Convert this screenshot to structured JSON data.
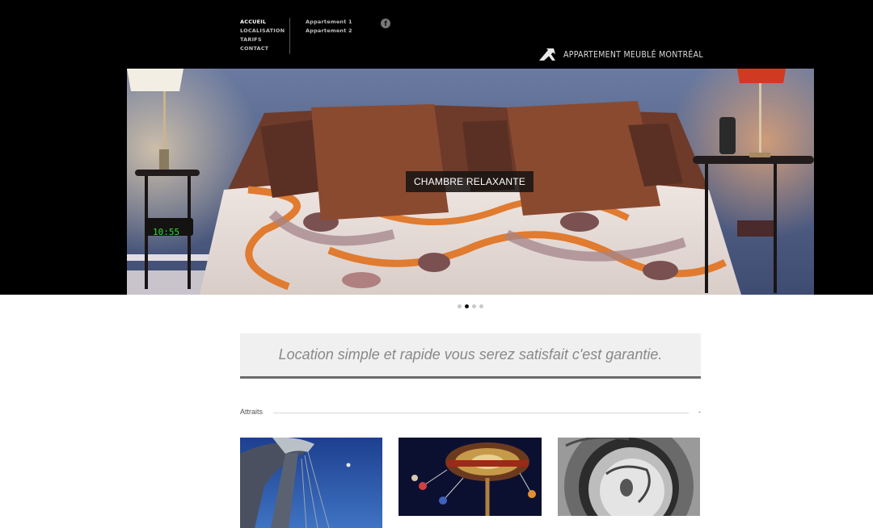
{
  "nav": {
    "primary": [
      {
        "label": "ACCUEIL",
        "active": true
      },
      {
        "label": "LOCALISATION",
        "active": false
      },
      {
        "label": "TARIFS",
        "active": false
      },
      {
        "label": "CONTACT",
        "active": false
      }
    ],
    "secondary": [
      {
        "label": "Appartement 1"
      },
      {
        "label": "Appartement 2"
      }
    ],
    "social_icon": "facebook-icon",
    "social_glyph": "f"
  },
  "logo": {
    "text": "APPARTEMENT MEUBLÉ MONTRÉAL"
  },
  "slider": {
    "caption": "CHAMBRE RELAXANTE",
    "clock_text": "10:55",
    "dots": [
      false,
      true,
      false,
      false
    ]
  },
  "tagline": "Location simple et rapide vous serez satisfait c'est garantie.",
  "attraits": {
    "label": "Attraits",
    "toggle": "-"
  },
  "colors": {
    "header_bg": "#000000",
    "tagline_bg": "#f0f0f0",
    "tagline_border": "#6b6b6b",
    "dot_active": "#111111",
    "dot_inactive": "#c9c9c9"
  }
}
